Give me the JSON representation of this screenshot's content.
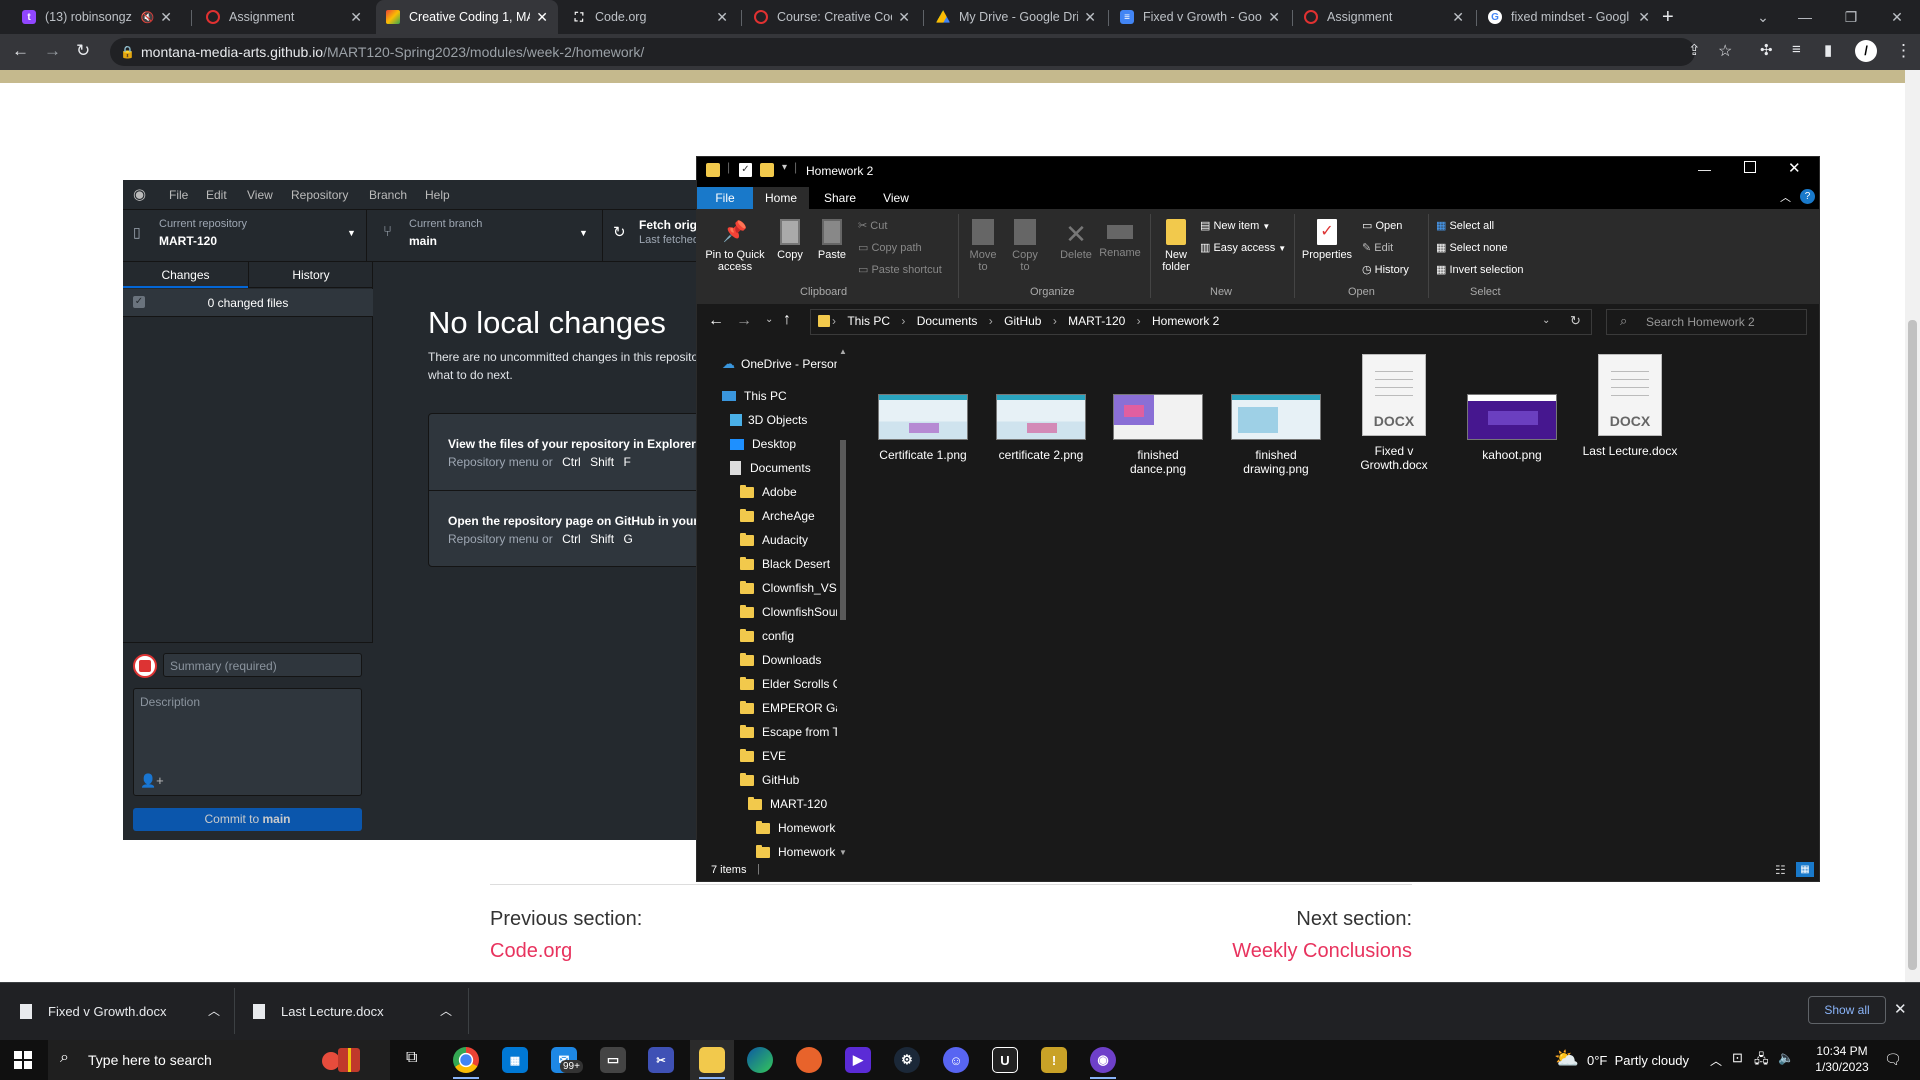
{
  "browser": {
    "tabs": [
      {
        "title": "(13) robinsongz -",
        "favicon_color": "#9146ff",
        "muted": true
      },
      {
        "title": "Assignment",
        "favicon_color": "#e03131"
      },
      {
        "title": "Creative Coding 1, MA",
        "favicon_color": "#34a853",
        "active": true
      },
      {
        "title": "Code.org",
        "favicon_color": "#59b9dc"
      },
      {
        "title": "Course: Creative Codi",
        "favicon_color": "#e03131"
      },
      {
        "title": "My Drive - Google Dri",
        "favicon_color": "#fbbc04"
      },
      {
        "title": "Fixed v Growth - Goo",
        "favicon_color": "#4285f4"
      },
      {
        "title": "Assignment",
        "favicon_color": "#e03131"
      },
      {
        "title": "fixed mindset - Googl",
        "favicon_color": "#ffffff"
      }
    ],
    "url_host": "montana-media-arts.github.io",
    "url_path": "/MART120-Spring2023/modules/week-2/homework/"
  },
  "page": {
    "prev_label": "Previous section:",
    "prev_link": "Code.org",
    "next_label": "Next section:",
    "next_link": "Weekly Conclusions"
  },
  "github_desktop": {
    "menu": [
      "File",
      "Edit",
      "View",
      "Repository",
      "Branch",
      "Help"
    ],
    "repo_label": "Current repository",
    "repo_value": "MART-120",
    "branch_label": "Current branch",
    "branch_value": "main",
    "fetch_label": "Fetch origi",
    "fetch_sub": "Last fetched",
    "tab_changes": "Changes",
    "tab_history": "History",
    "changed_files": "0 changed files",
    "no_changes_title": "No local changes",
    "no_changes_text1": "There are no uncommitted changes in this reposito",
    "no_changes_text2": "what to do next.",
    "card1_title": "View the files of your repository in Explorer",
    "card1_hint": "Repository menu or",
    "card1_keys": [
      "Ctrl",
      "Shift",
      "F"
    ],
    "card2_title": "Open the repository page on GitHub in your b",
    "card2_hint": "Repository menu or",
    "card2_keys": [
      "Ctrl",
      "Shift",
      "G"
    ],
    "summary_placeholder": "Summary (required)",
    "description_placeholder": "Description",
    "commit_prefix": "Commit to ",
    "commit_branch": "main"
  },
  "explorer": {
    "title": "Homework 2",
    "ribbon_tabs": [
      "File",
      "Home",
      "Share",
      "View"
    ],
    "clipboard": {
      "pin": "Pin to Quick access",
      "copy": "Copy",
      "paste": "Paste",
      "cut": "Cut",
      "copy_path": "Copy path",
      "paste_shortcut": "Paste shortcut",
      "group": "Clipboard"
    },
    "organize": {
      "move_to": "Move to",
      "copy_to": "Copy to",
      "delete": "Delete",
      "rename": "Rename",
      "group": "Organize"
    },
    "new": {
      "new_folder": "New folder",
      "new_item": "New item",
      "easy_access": "Easy access",
      "group": "New"
    },
    "open": {
      "properties": "Properties",
      "open": "Open",
      "edit": "Edit",
      "history": "History",
      "group": "Open"
    },
    "select": {
      "select_all": "Select all",
      "select_none": "Select none",
      "invert": "Invert selection",
      "group": "Select"
    },
    "breadcrumb": [
      "This PC",
      "Documents",
      "GitHub",
      "MART-120",
      "Homework 2"
    ],
    "search_placeholder": "Search Homework 2",
    "nav": [
      {
        "label": "OneDrive - Person",
        "kind": "cloud",
        "indent": 0
      },
      {
        "label": "This PC",
        "kind": "pc",
        "indent": 0
      },
      {
        "label": "3D Objects",
        "kind": "cube",
        "indent": 1
      },
      {
        "label": "Desktop",
        "kind": "desktop",
        "indent": 1
      },
      {
        "label": "Documents",
        "kind": "doc",
        "indent": 1
      },
      {
        "label": "Adobe",
        "kind": "folder",
        "indent": 2
      },
      {
        "label": "ArcheAge",
        "kind": "folder",
        "indent": 2
      },
      {
        "label": "Audacity",
        "kind": "folder",
        "indent": 2
      },
      {
        "label": "Black Desert",
        "kind": "folder",
        "indent": 2
      },
      {
        "label": "Clownfish_VST",
        "kind": "folder",
        "indent": 2
      },
      {
        "label": "ClownfishSour",
        "kind": "folder",
        "indent": 2
      },
      {
        "label": "config",
        "kind": "folder",
        "indent": 2
      },
      {
        "label": "Downloads",
        "kind": "folder",
        "indent": 2
      },
      {
        "label": "Elder Scrolls Or",
        "kind": "folder",
        "indent": 2
      },
      {
        "label": "EMPEROR Gam",
        "kind": "folder",
        "indent": 2
      },
      {
        "label": "Escape from Ta",
        "kind": "folder",
        "indent": 2
      },
      {
        "label": "EVE",
        "kind": "folder",
        "indent": 2
      },
      {
        "label": "GitHub",
        "kind": "folder",
        "indent": 2
      },
      {
        "label": "MART-120",
        "kind": "folder",
        "indent": 3
      },
      {
        "label": "Homework",
        "kind": "folder",
        "indent": 4
      },
      {
        "label": "Homework",
        "kind": "folder",
        "indent": 4
      }
    ],
    "files": [
      {
        "name1": "Certificate 1.png",
        "name2": "",
        "kind": "img"
      },
      {
        "name1": "certificate 2.png",
        "name2": "",
        "kind": "img"
      },
      {
        "name1": "finished",
        "name2": "dance.png",
        "kind": "img"
      },
      {
        "name1": "finished",
        "name2": "drawing.png",
        "kind": "img"
      },
      {
        "name1": "Fixed v",
        "name2": "Growth.docx",
        "kind": "docx"
      },
      {
        "name1": "kahoot.png",
        "name2": "",
        "kind": "img"
      },
      {
        "name1": "Last Lecture.docx",
        "name2": "",
        "kind": "docx"
      }
    ],
    "docx_label": "DOCX",
    "status": "7 items"
  },
  "downloads": {
    "items": [
      "Fixed v Growth.docx",
      "Last Lecture.docx"
    ],
    "show_all": "Show all"
  },
  "taskbar": {
    "search_placeholder": "Type here to search",
    "mail_badge": "99+",
    "weather_temp": "0°F",
    "weather_text": "Partly cloudy",
    "time": "10:34 PM",
    "date": "1/30/2023"
  }
}
